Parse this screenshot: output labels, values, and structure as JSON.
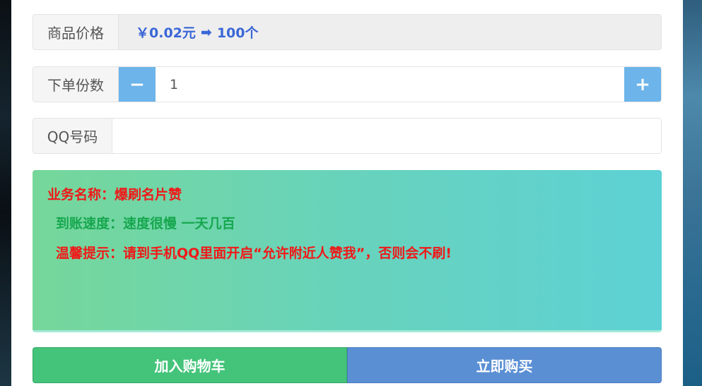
{
  "price_row": {
    "label": "商品价格",
    "price": "￥0.02元",
    "arrow": "➡",
    "quantity": "100个"
  },
  "quantity_row": {
    "label": "下单份数",
    "minus": "−",
    "value": "1",
    "plus": "+"
  },
  "qq_row": {
    "label": "QQ号码",
    "value": ""
  },
  "info": {
    "service_name": "业务名称：爆刷名片赞",
    "speed": "到账速度：速度很慢 一天几百",
    "tip": "温馨提示：请到手机QQ里面开启“允许附近人赞我”，否则会不刷!"
  },
  "buttons": {
    "add_to_cart": "加入购物车",
    "buy_now": "立即购买"
  },
  "colors": {
    "price_text": "#3a66d6",
    "stepper": "#6cb4ea",
    "service_name": "#f01818",
    "speed": "#16a74e",
    "tip": "#f01818",
    "add_to_cart": "#44c47a",
    "buy_now": "#5b8fd4"
  }
}
